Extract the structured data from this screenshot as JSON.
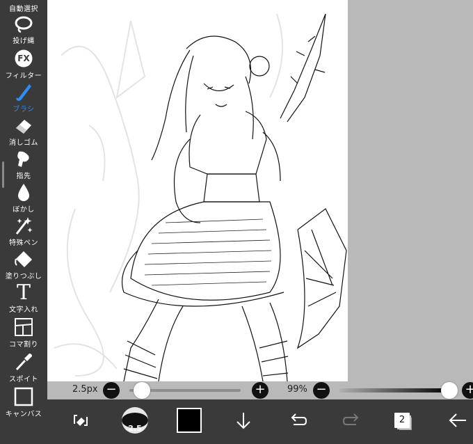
{
  "sidebar": {
    "tools": [
      {
        "label": "自動選択",
        "icon": "auto-select-icon"
      },
      {
        "label": "投げ縄",
        "icon": "lasso-icon"
      },
      {
        "label": "フィルター",
        "icon": "fx-icon",
        "fx": "FX"
      },
      {
        "label": "ブラシ",
        "icon": "brush-icon",
        "active": true
      },
      {
        "label": "消しゴム",
        "icon": "eraser-icon"
      },
      {
        "label": "指先",
        "icon": "finger-icon"
      },
      {
        "label": "ぼかし",
        "icon": "blur-drop-icon"
      },
      {
        "label": "特殊ペン",
        "icon": "special-pen-icon"
      },
      {
        "label": "塗りつぶし",
        "icon": "fill-bucket-icon"
      },
      {
        "label": "文字入れ",
        "icon": "text-icon",
        "glyph": "T"
      },
      {
        "label": "コマ割り",
        "icon": "frame-divide-icon"
      },
      {
        "label": "スポイト",
        "icon": "eyedropper-icon"
      },
      {
        "label": "キャンバス",
        "icon": "canvas-icon"
      }
    ],
    "active_color": "#2f8df2"
  },
  "brush_size": {
    "value_label": "2.5px",
    "minus": "−",
    "plus": "+",
    "level": 0.05
  },
  "opacity": {
    "value_label": "99%",
    "minus": "−",
    "plus": "+",
    "level": 0.99
  },
  "bottom_bar": {
    "transform_icon": "transform-icon",
    "brush_preview_value": "2.5",
    "current_color": "#000000",
    "layer_count": "2",
    "icons": [
      "down-arrow-icon",
      "undo-icon",
      "redo-icon",
      "back-arrow-icon"
    ]
  }
}
